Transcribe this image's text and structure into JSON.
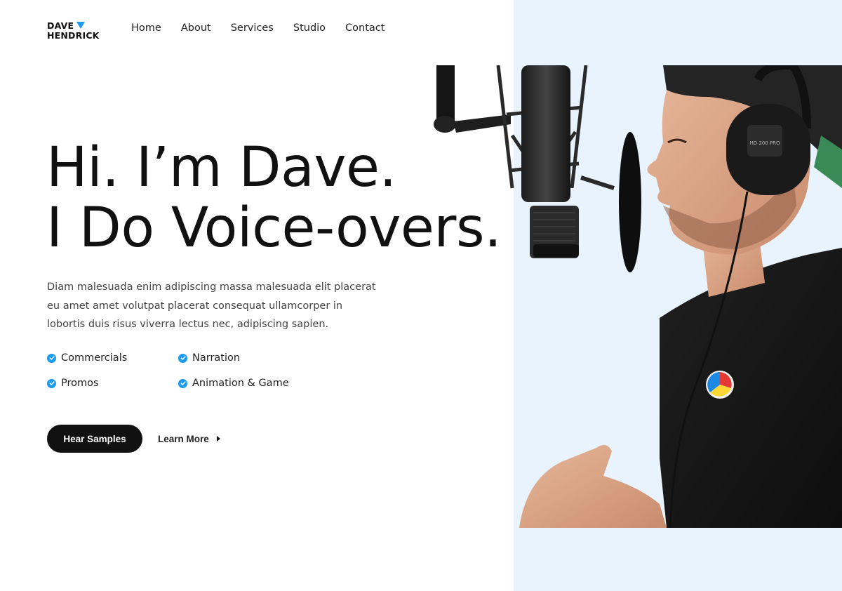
{
  "brand": {
    "line1": "DAVE",
    "line2": "HENDRICK",
    "accent_color": "#1a9bf0"
  },
  "nav": {
    "items": [
      {
        "label": "Home"
      },
      {
        "label": "About"
      },
      {
        "label": "Services"
      },
      {
        "label": "Studio"
      },
      {
        "label": "Contact"
      }
    ]
  },
  "hero": {
    "title_line1": "Hi. I’m Dave.",
    "title_line2": "I Do Voice-overs.",
    "description": "Diam malesuada enim adipiscing massa malesuada elit placerat eu amet amet volutpat placerat consequat ullamcorper in lobortis duis risus viverra lectus nec, adipiscing sapien.",
    "features": [
      {
        "label": "Commercials",
        "icon": "check-circle-icon"
      },
      {
        "label": "Narration",
        "icon": "check-circle-icon"
      },
      {
        "label": "Promos",
        "icon": "check-circle-icon"
      },
      {
        "label": "Animation & Game",
        "icon": "check-circle-icon"
      }
    ],
    "primary_button": "Hear Samples",
    "secondary_link": "Learn More"
  },
  "photo": {
    "headphone_label": "HD 200 PRO"
  },
  "colors": {
    "panel_background": "#e9f3fd",
    "check_icon": "#1a9bf0",
    "button": "#111111"
  }
}
